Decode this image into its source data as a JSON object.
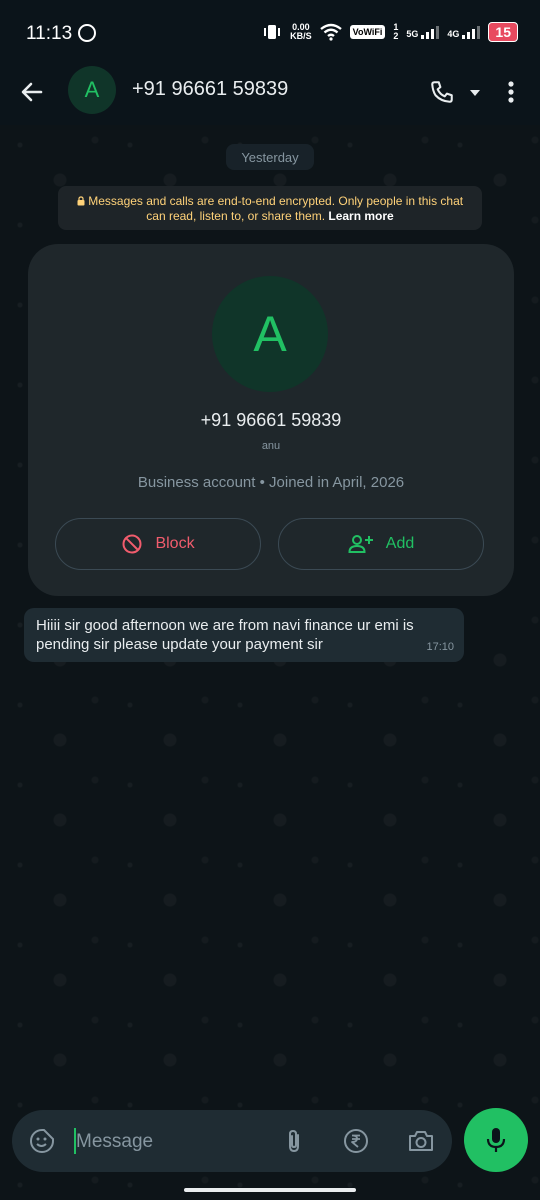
{
  "status_bar": {
    "time": "11:13",
    "speed_value": "0.00",
    "speed_unit": "KB/S",
    "vowifi": "VoWiFi",
    "sim1_top": "1",
    "sim1_bottom": "2",
    "net1": "5G",
    "net2": "4G",
    "battery": "15",
    "icons": [
      "whatsapp-icon",
      "vibrate-icon",
      "wifi-icon",
      "signal-icon",
      "battery-icon"
    ]
  },
  "header": {
    "avatar_letter": "A",
    "title": "+91 96661 59839",
    "icons": [
      "back-arrow-icon",
      "phone-icon",
      "caret-down-icon",
      "more-vert-icon"
    ]
  },
  "chat": {
    "date_chip": "Yesterday",
    "encryption_text": "Messages and calls are end-to-end encrypted. Only people in this chat can read, listen to, or share them.",
    "encryption_link": "Learn more",
    "profile_card": {
      "avatar_letter": "A",
      "number": "+91 96661 59839",
      "name": "anu",
      "info": "Business account • Joined in April, 2026",
      "block_label": "Block",
      "add_label": "Add"
    },
    "messages": [
      {
        "text": "Hiiii sir good afternoon we are from navi finance ur emi is pending sir please update your payment sir",
        "time": "17:10"
      }
    ]
  },
  "composer": {
    "placeholder": "Message",
    "icons": [
      "sticker-icon",
      "attach-icon",
      "rupee-icon",
      "camera-icon",
      "mic-icon"
    ]
  },
  "colors": {
    "accent": "#21c063",
    "danger": "#f15c6d",
    "background": "#0b141a",
    "bubble": "#1f2c33"
  }
}
